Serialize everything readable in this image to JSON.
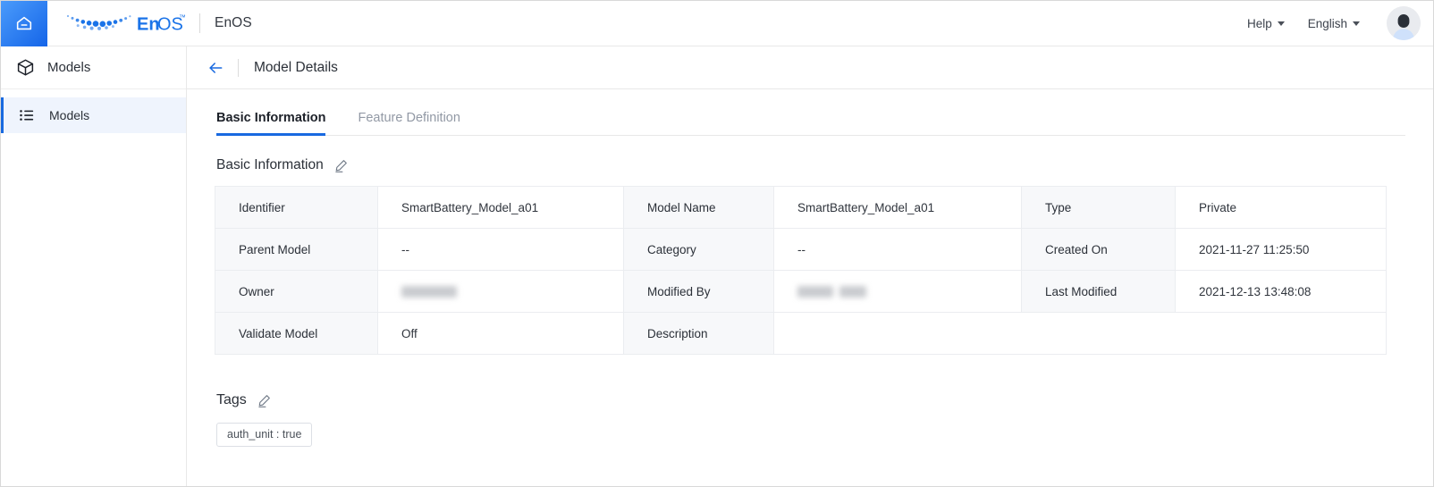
{
  "topbar": {
    "home_icon": "home-icon",
    "brand_logo_alt": "enos-logo",
    "brand_name": "EnOS",
    "product_title": "EnOS",
    "help_label": "Help",
    "language_label": "English",
    "avatar_alt": "user-avatar"
  },
  "sidebar": {
    "header": {
      "icon": "cube-icon",
      "label": "Models"
    },
    "items": [
      {
        "icon": "list-icon",
        "label": "Models",
        "active": true
      }
    ]
  },
  "page": {
    "back_icon": "arrow-left-icon",
    "title": "Model Details"
  },
  "tabs": [
    {
      "label": "Basic Information",
      "active": true
    },
    {
      "label": "Feature Definition",
      "active": false
    }
  ],
  "basic_information": {
    "section_title": "Basic Information",
    "edit_icon": "pencil-edit-icon",
    "rows": [
      {
        "label1": "Identifier",
        "value1": "SmartBattery_Model_a01",
        "value1_redacted": false,
        "label2": "Model Name",
        "value2": "SmartBattery_Model_a01",
        "value2_redacted": false,
        "label3": "Type",
        "value3": "Private"
      },
      {
        "label1": "Parent Model",
        "value1": "--",
        "value1_redacted": false,
        "label2": "Category",
        "value2": "--",
        "value2_redacted": false,
        "label3": "Created On",
        "value3": "2021-11-27 11:25:50"
      },
      {
        "label1": "Owner",
        "value1": "",
        "value1_redacted": true,
        "label2": "Modified By",
        "value2": "",
        "value2_redacted": true,
        "label3": "Last Modified",
        "value3": "2021-12-13 13:48:08"
      },
      {
        "label1": "Validate Model",
        "value1": "Off",
        "value1_redacted": false,
        "label2": "Description",
        "value2": "",
        "value2_redacted": false,
        "label3": "",
        "value3": ""
      }
    ]
  },
  "tags": {
    "section_title": "Tags",
    "edit_icon": "pencil-edit-icon",
    "chips": [
      {
        "label": "auth_unit : true"
      }
    ]
  },
  "colors": {
    "accent_blue": "#1869e0",
    "brand_blue": "#1a73e8",
    "header_bg": "#f7f8fa",
    "border": "#ebedf0",
    "text_primary": "#2b3038",
    "text_muted": "#9299a5"
  }
}
